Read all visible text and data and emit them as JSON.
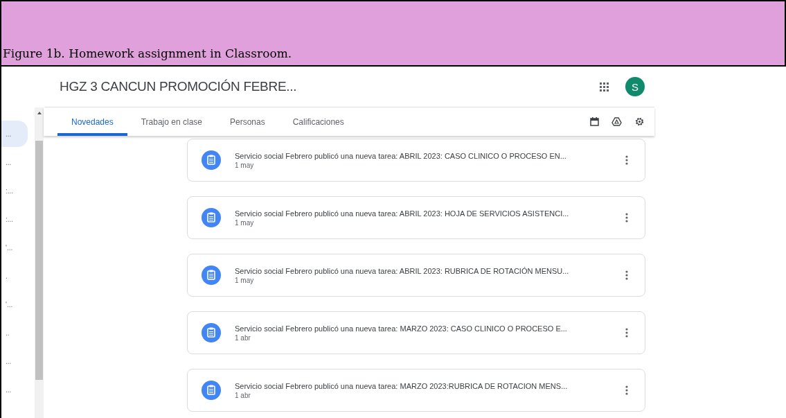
{
  "caption": "Figure 1b. Homework assignment in Classroom.",
  "app": {
    "course_title": "HGZ 3 CANCUN PROMOCIÓN FEBRE...",
    "avatar": "S"
  },
  "sidebar": {
    "items": [
      {
        "label": "...",
        "selected": true
      },
      {
        "label": "...",
        "selected": false
      },
      {
        "label": ":...",
        "selected": false
      },
      {
        "label": ":...",
        "selected": false
      },
      {
        "label": "'...",
        "selected": false
      },
      {
        "label": ".",
        "selected": false
      },
      {
        "label": "'...",
        "selected": false
      },
      {
        "label": "..",
        "selected": false
      },
      {
        "label": "...",
        "selected": false
      },
      {
        "label": "...",
        "selected": false
      }
    ]
  },
  "tabs": [
    {
      "label": "Novedades",
      "selected": true
    },
    {
      "label": "Trabajo en clase",
      "selected": false
    },
    {
      "label": "Personas",
      "selected": false
    },
    {
      "label": "Calificaciones",
      "selected": false
    }
  ],
  "posts": [
    {
      "text": "Servicio social Febrero publicó una nueva tarea: ABRIL 2023: CASO CLINICO O PROCESO EN...",
      "date": "1 may"
    },
    {
      "text": "Servicio social Febrero publicó una nueva tarea: ABRIL 2023: HOJA DE SERVICIOS ASISTENCI...",
      "date": "1 may"
    },
    {
      "text": "Servicio social Febrero publicó una nueva tarea: ABRIL 2023: RUBRICA DE ROTACIÓN MENSU...",
      "date": "1 may"
    },
    {
      "text": "Servicio social Febrero publicó una nueva tarea: MARZO 2023: CASO CLINICO O PROCESO E...",
      "date": "1 abr"
    },
    {
      "text": "Servicio social Febrero publicó una nueva tarea: MARZO 2023:RUBRICA DE ROTACION MENS...",
      "date": "1 abr"
    }
  ]
}
